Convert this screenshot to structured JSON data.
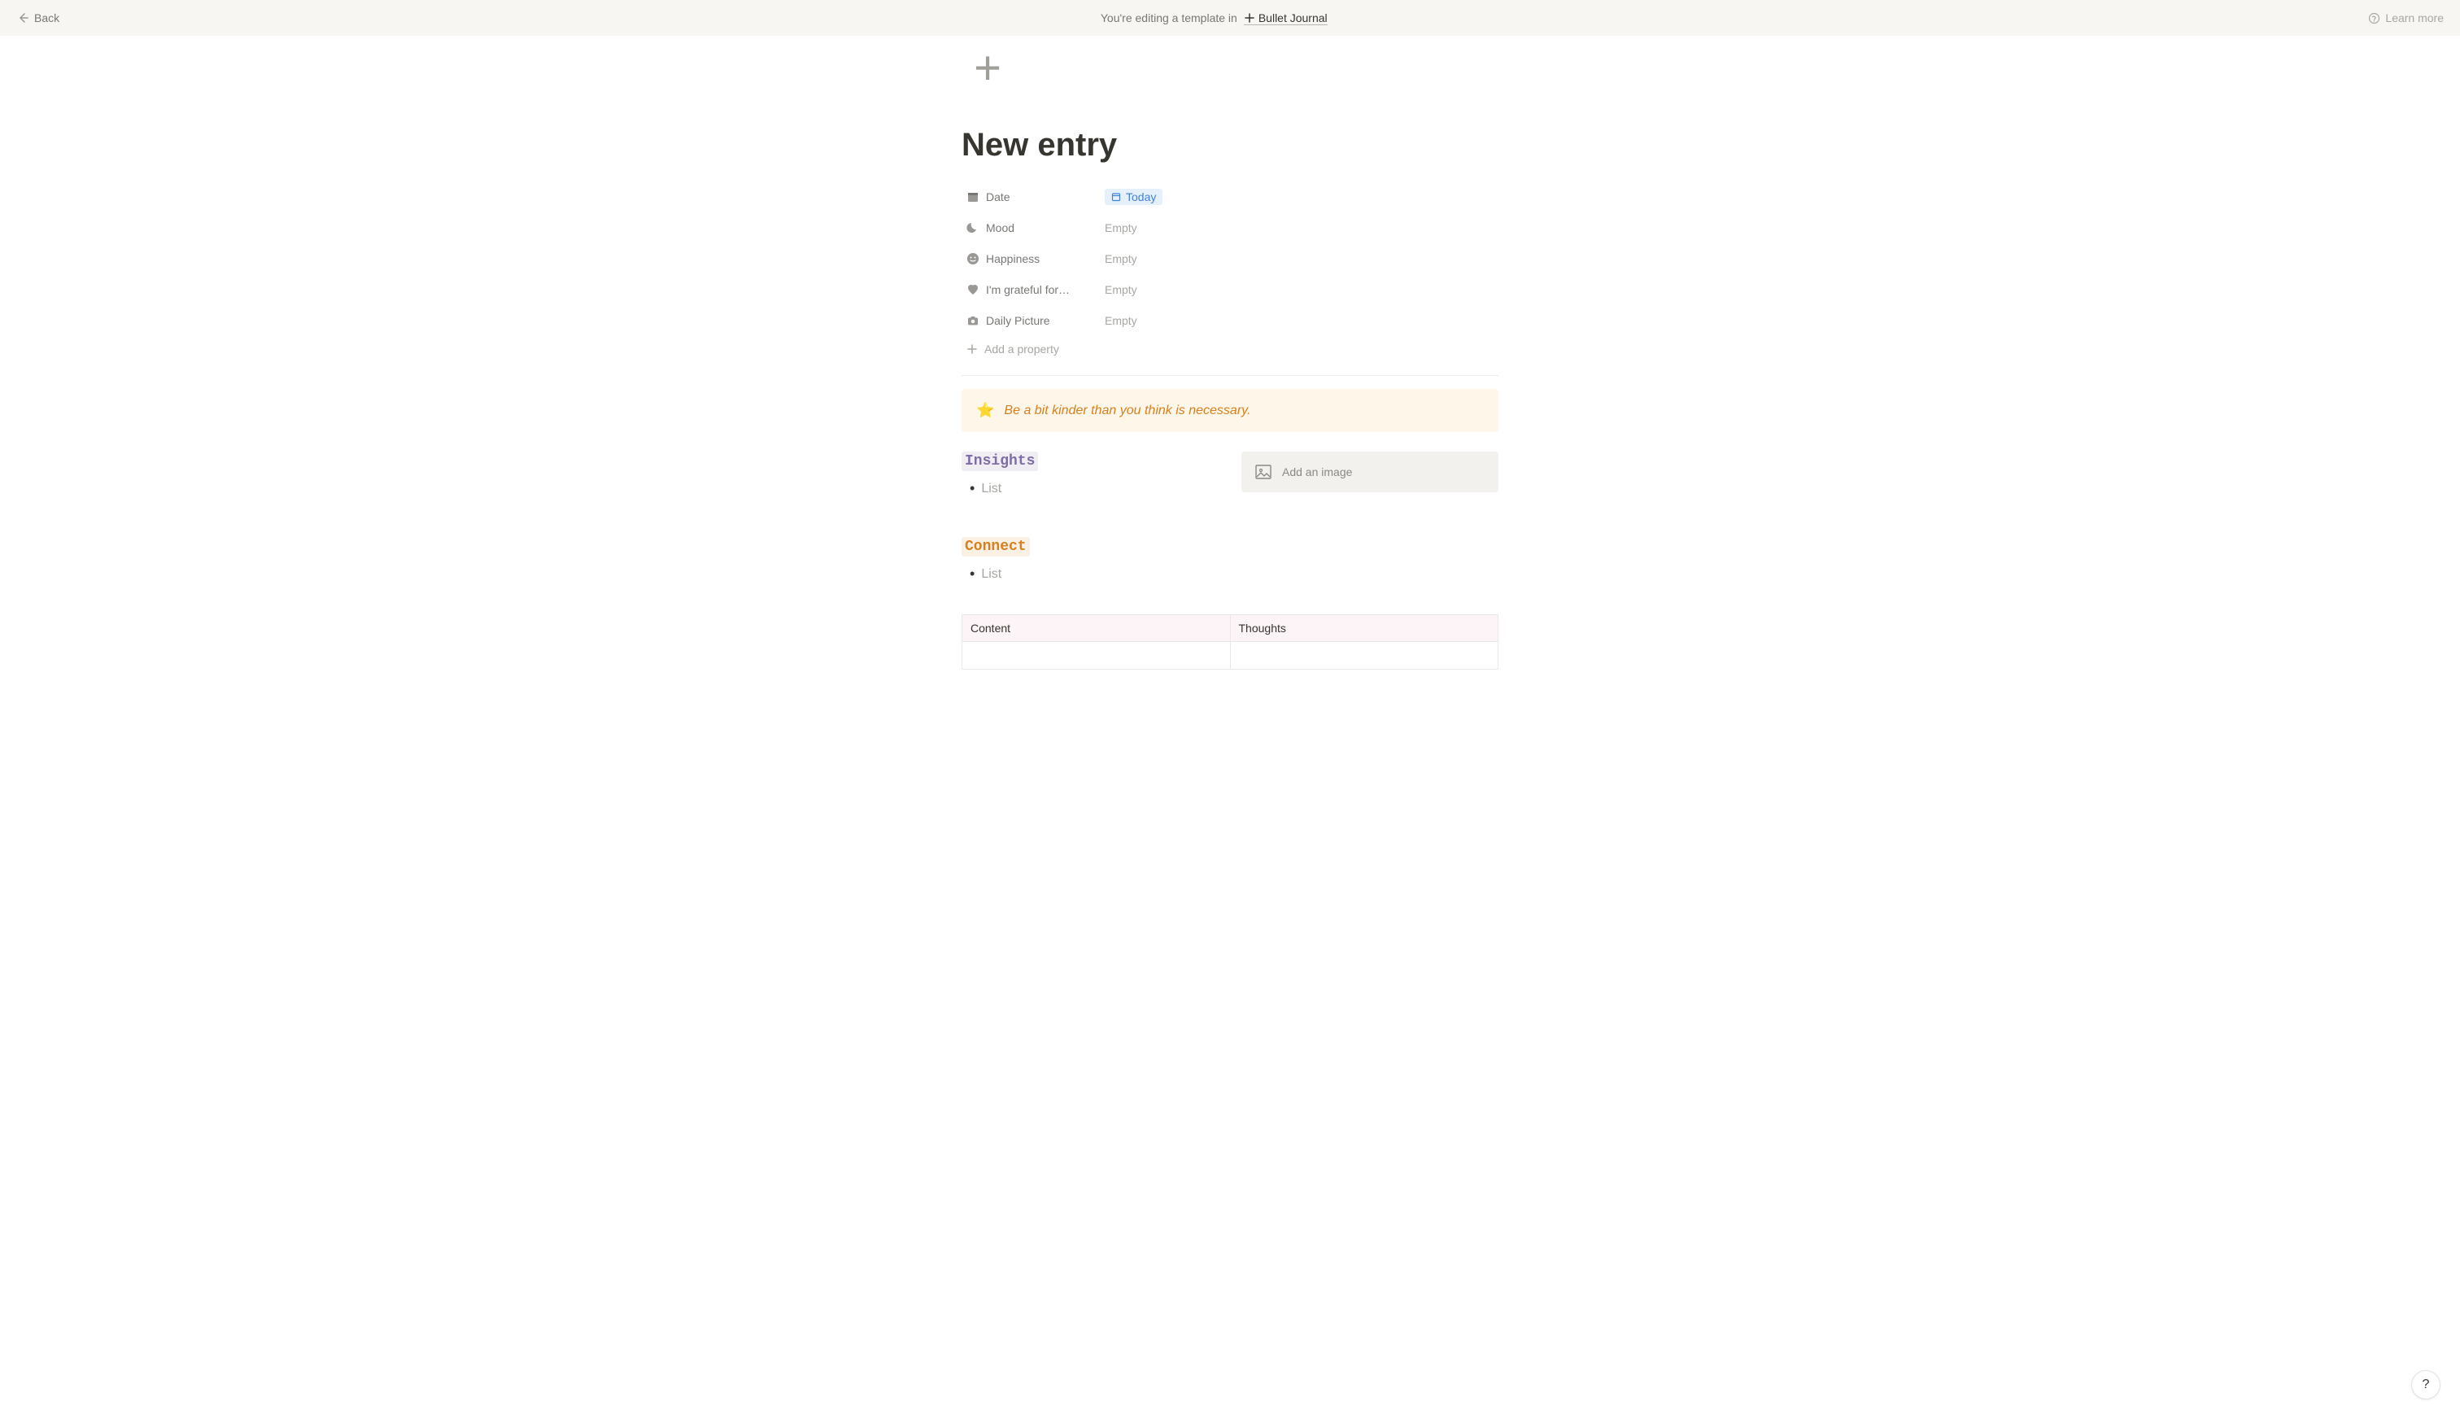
{
  "topbar": {
    "back_label": "Back",
    "editing_prefix": "You're editing a template in",
    "template_name": "Bullet Journal",
    "learn_more": "Learn more"
  },
  "page": {
    "title": "New entry"
  },
  "properties": [
    {
      "icon": "calendar",
      "label": "Date",
      "value": "Today",
      "is_date": true
    },
    {
      "icon": "moon",
      "label": "Mood",
      "value": "Empty",
      "empty": true
    },
    {
      "icon": "face",
      "label": "Happiness",
      "value": "Empty",
      "empty": true
    },
    {
      "icon": "heart",
      "label": "I'm grateful for…",
      "value": "Empty",
      "empty": true
    },
    {
      "icon": "camera",
      "label": "Daily Picture",
      "value": "Empty",
      "empty": true
    }
  ],
  "add_property_label": "Add a property",
  "callout": {
    "emoji": "⭐",
    "text": "Be a bit kinder than you think is necessary."
  },
  "sections": {
    "insights": {
      "label": "Insights",
      "item": "List"
    },
    "connect": {
      "label": "Connect",
      "item": "List"
    }
  },
  "image_placeholder": "Add an image",
  "table": {
    "headers": [
      "Content",
      "Thoughts"
    ]
  },
  "help": "?"
}
